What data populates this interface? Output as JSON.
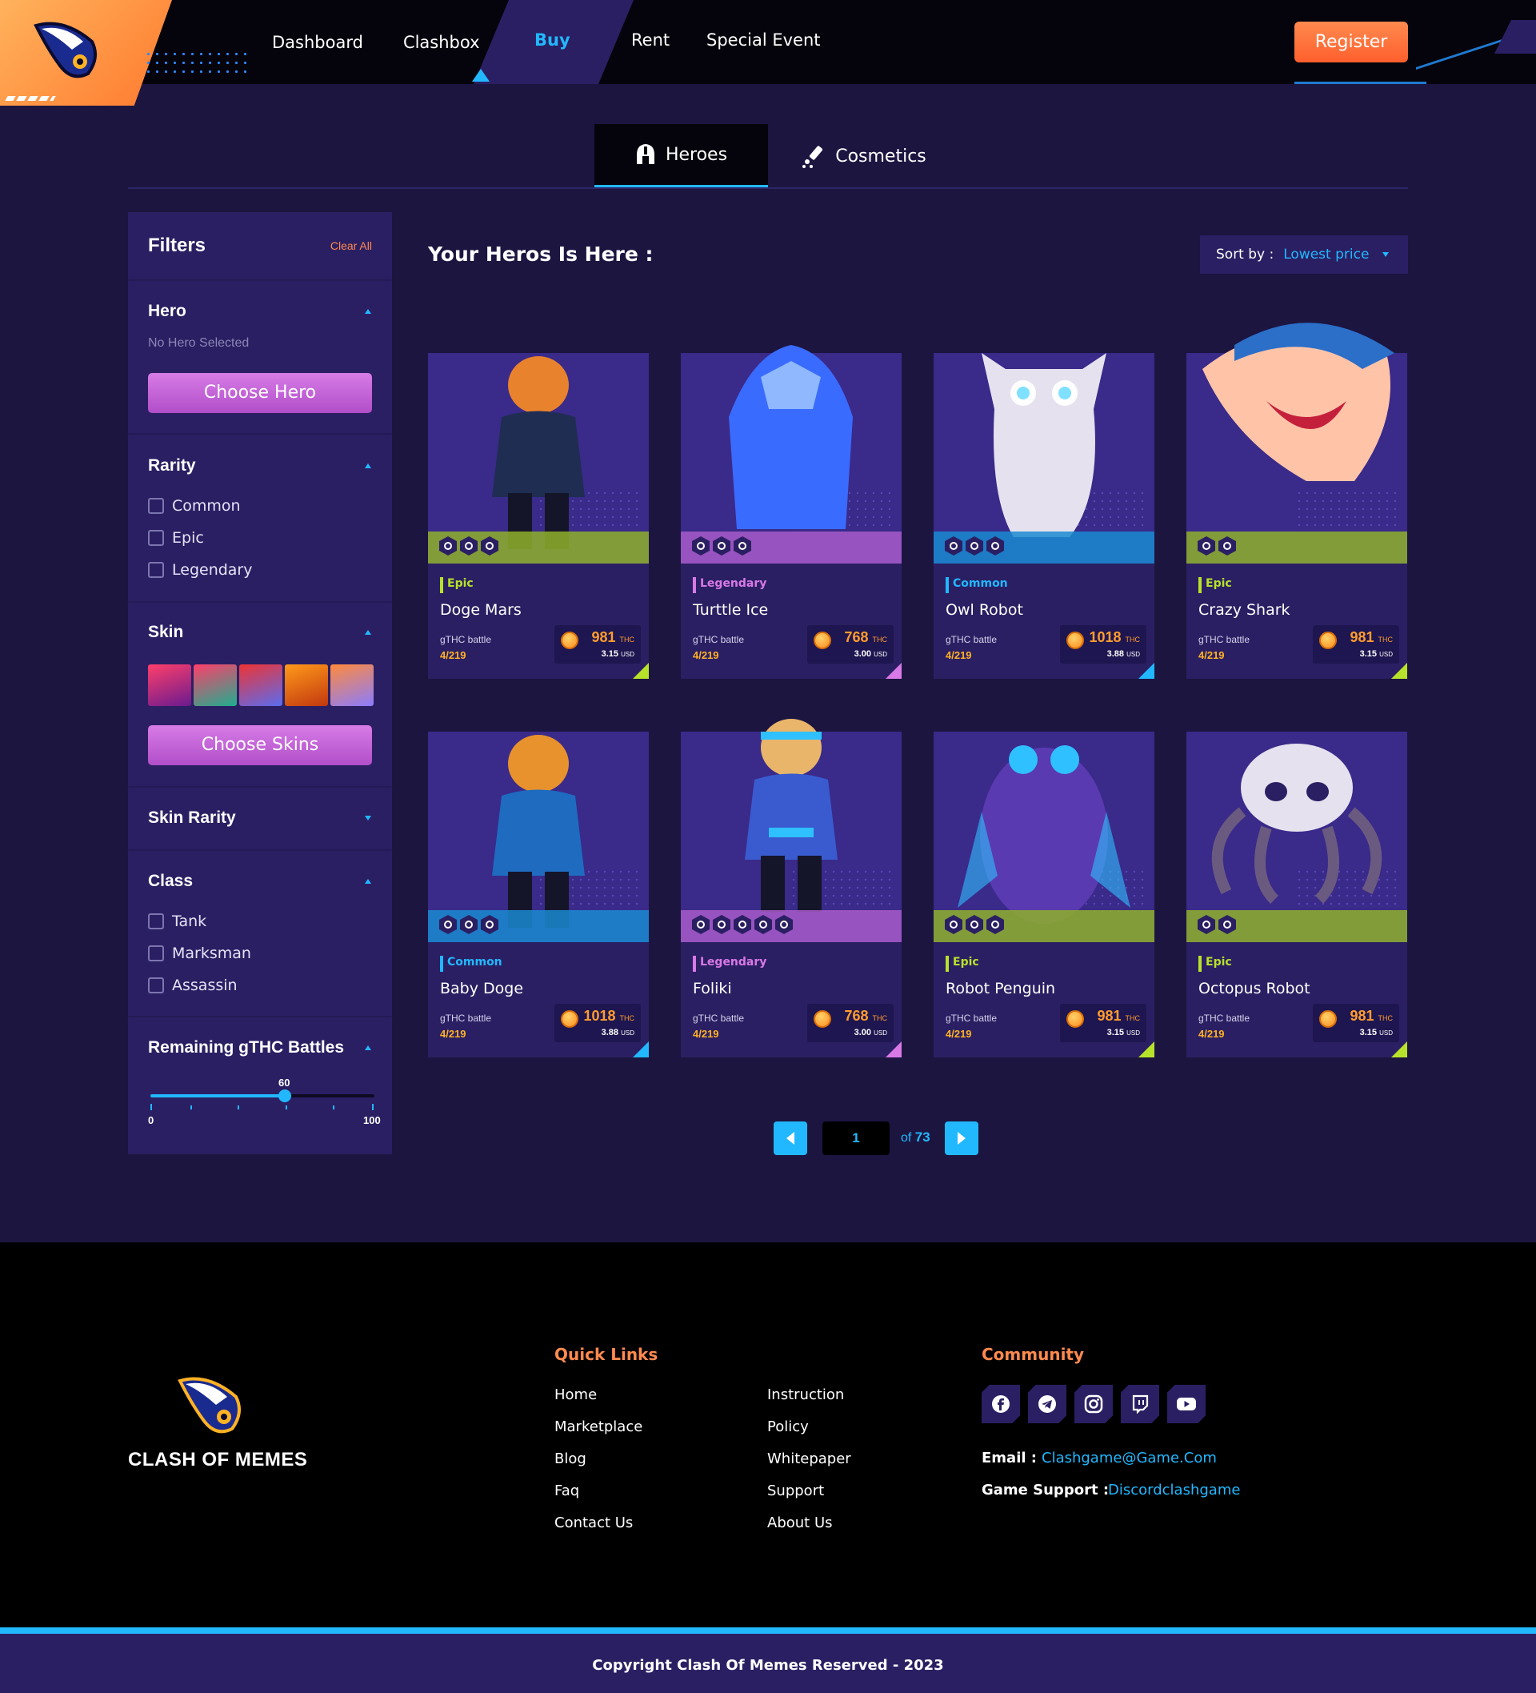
{
  "colors": {
    "accent": "#22b8ff",
    "orange": "#ff8a4f",
    "panel": "#2b1f63",
    "bg": "#1c1540",
    "epic": "#b7e22a",
    "legendary": "#d879e6",
    "common": "#22b8ff"
  },
  "nav": {
    "items": [
      "Dashboard",
      "Clashbox"
    ],
    "active": "Buy",
    "after": [
      "Rent",
      "Special Event"
    ],
    "register": "Register"
  },
  "tabs": {
    "heroes": "Heroes",
    "cosmetics": "Cosmetics"
  },
  "filters": {
    "title": "Filters",
    "clear": "Clear All",
    "hero": {
      "title": "Hero",
      "status": "No Hero Selected",
      "button": "Choose Hero"
    },
    "rarity": {
      "title": "Rarity",
      "options": [
        "Common",
        "Epic",
        "Legendary"
      ]
    },
    "skin": {
      "title": "Skin",
      "button": "Choose Skins"
    },
    "skin_rarity": {
      "title": "Skin Rarity"
    },
    "class": {
      "title": "Class",
      "options": [
        "Tank",
        "Marksman",
        "Assassin"
      ]
    },
    "battles": {
      "title": "Remaining gTHC Battles",
      "value": "60",
      "min": "0",
      "max": "100",
      "value_num": 60
    }
  },
  "main": {
    "title": "Your Heros Is Here :",
    "sort_label": "Sort by :",
    "sort_value": "Lowest price"
  },
  "cards": [
    {
      "rarity": "Epic",
      "name": "Doge Mars",
      "battle": "gTHC battle",
      "count": "4/219",
      "thc": "981",
      "usd": "3.15",
      "unit_thc": "THC",
      "unit_usd": "USD"
    },
    {
      "rarity": "Legendary",
      "name": "Turttle Ice",
      "battle": "gTHC battle",
      "count": "4/219",
      "thc": "768",
      "usd": "3.00",
      "unit_thc": "THC",
      "unit_usd": "USD"
    },
    {
      "rarity": "Common",
      "name": "Owl Robot",
      "battle": "gTHC battle",
      "count": "4/219",
      "thc": "1018",
      "usd": "3.88",
      "unit_thc": "THC",
      "unit_usd": "USD"
    },
    {
      "rarity": "Epic",
      "name": "Crazy Shark",
      "battle": "gTHC battle",
      "count": "4/219",
      "thc": "981",
      "usd": "3.15",
      "unit_thc": "THC",
      "unit_usd": "USD"
    },
    {
      "rarity": "Common",
      "name": "Baby Doge",
      "battle": "gTHC battle",
      "count": "4/219",
      "thc": "1018",
      "usd": "3.88",
      "unit_thc": "THC",
      "unit_usd": "USD"
    },
    {
      "rarity": "Legendary",
      "name": "Foliki",
      "battle": "gTHC battle",
      "count": "4/219",
      "thc": "768",
      "usd": "3.00",
      "unit_thc": "THC",
      "unit_usd": "USD"
    },
    {
      "rarity": "Epic",
      "name": "Robot Penguin",
      "battle": "gTHC battle",
      "count": "4/219",
      "thc": "981",
      "usd": "3.15",
      "unit_thc": "THC",
      "unit_usd": "USD"
    },
    {
      "rarity": "Epic",
      "name": "Octopus Robot",
      "battle": "gTHC battle",
      "count": "4/219",
      "thc": "981",
      "usd": "3.15",
      "unit_thc": "THC",
      "unit_usd": "USD"
    }
  ],
  "pagination": {
    "current": "1",
    "of_label": "of",
    "total": "73"
  },
  "footer": {
    "brand": "CLASH OF MEMES",
    "quick_title": "Quick Links",
    "links_col1": [
      "Home",
      "Marketplace",
      "Blog",
      "Faq",
      "Contact Us"
    ],
    "links_col2": [
      "Instruction",
      "Policy",
      "Whitepaper",
      "Support",
      "About Us"
    ],
    "community_title": "Community",
    "socials": [
      "facebook-icon",
      "telegram-icon",
      "instagram-icon",
      "twitch-icon",
      "youtube-icon"
    ],
    "email_label": "Email :",
    "email": "Clashgame@Game.Com",
    "support_label": "Game Support :",
    "support": "Discordclashgame",
    "copyright": "Copyright Clash Of Memes Reserved - 2023"
  }
}
